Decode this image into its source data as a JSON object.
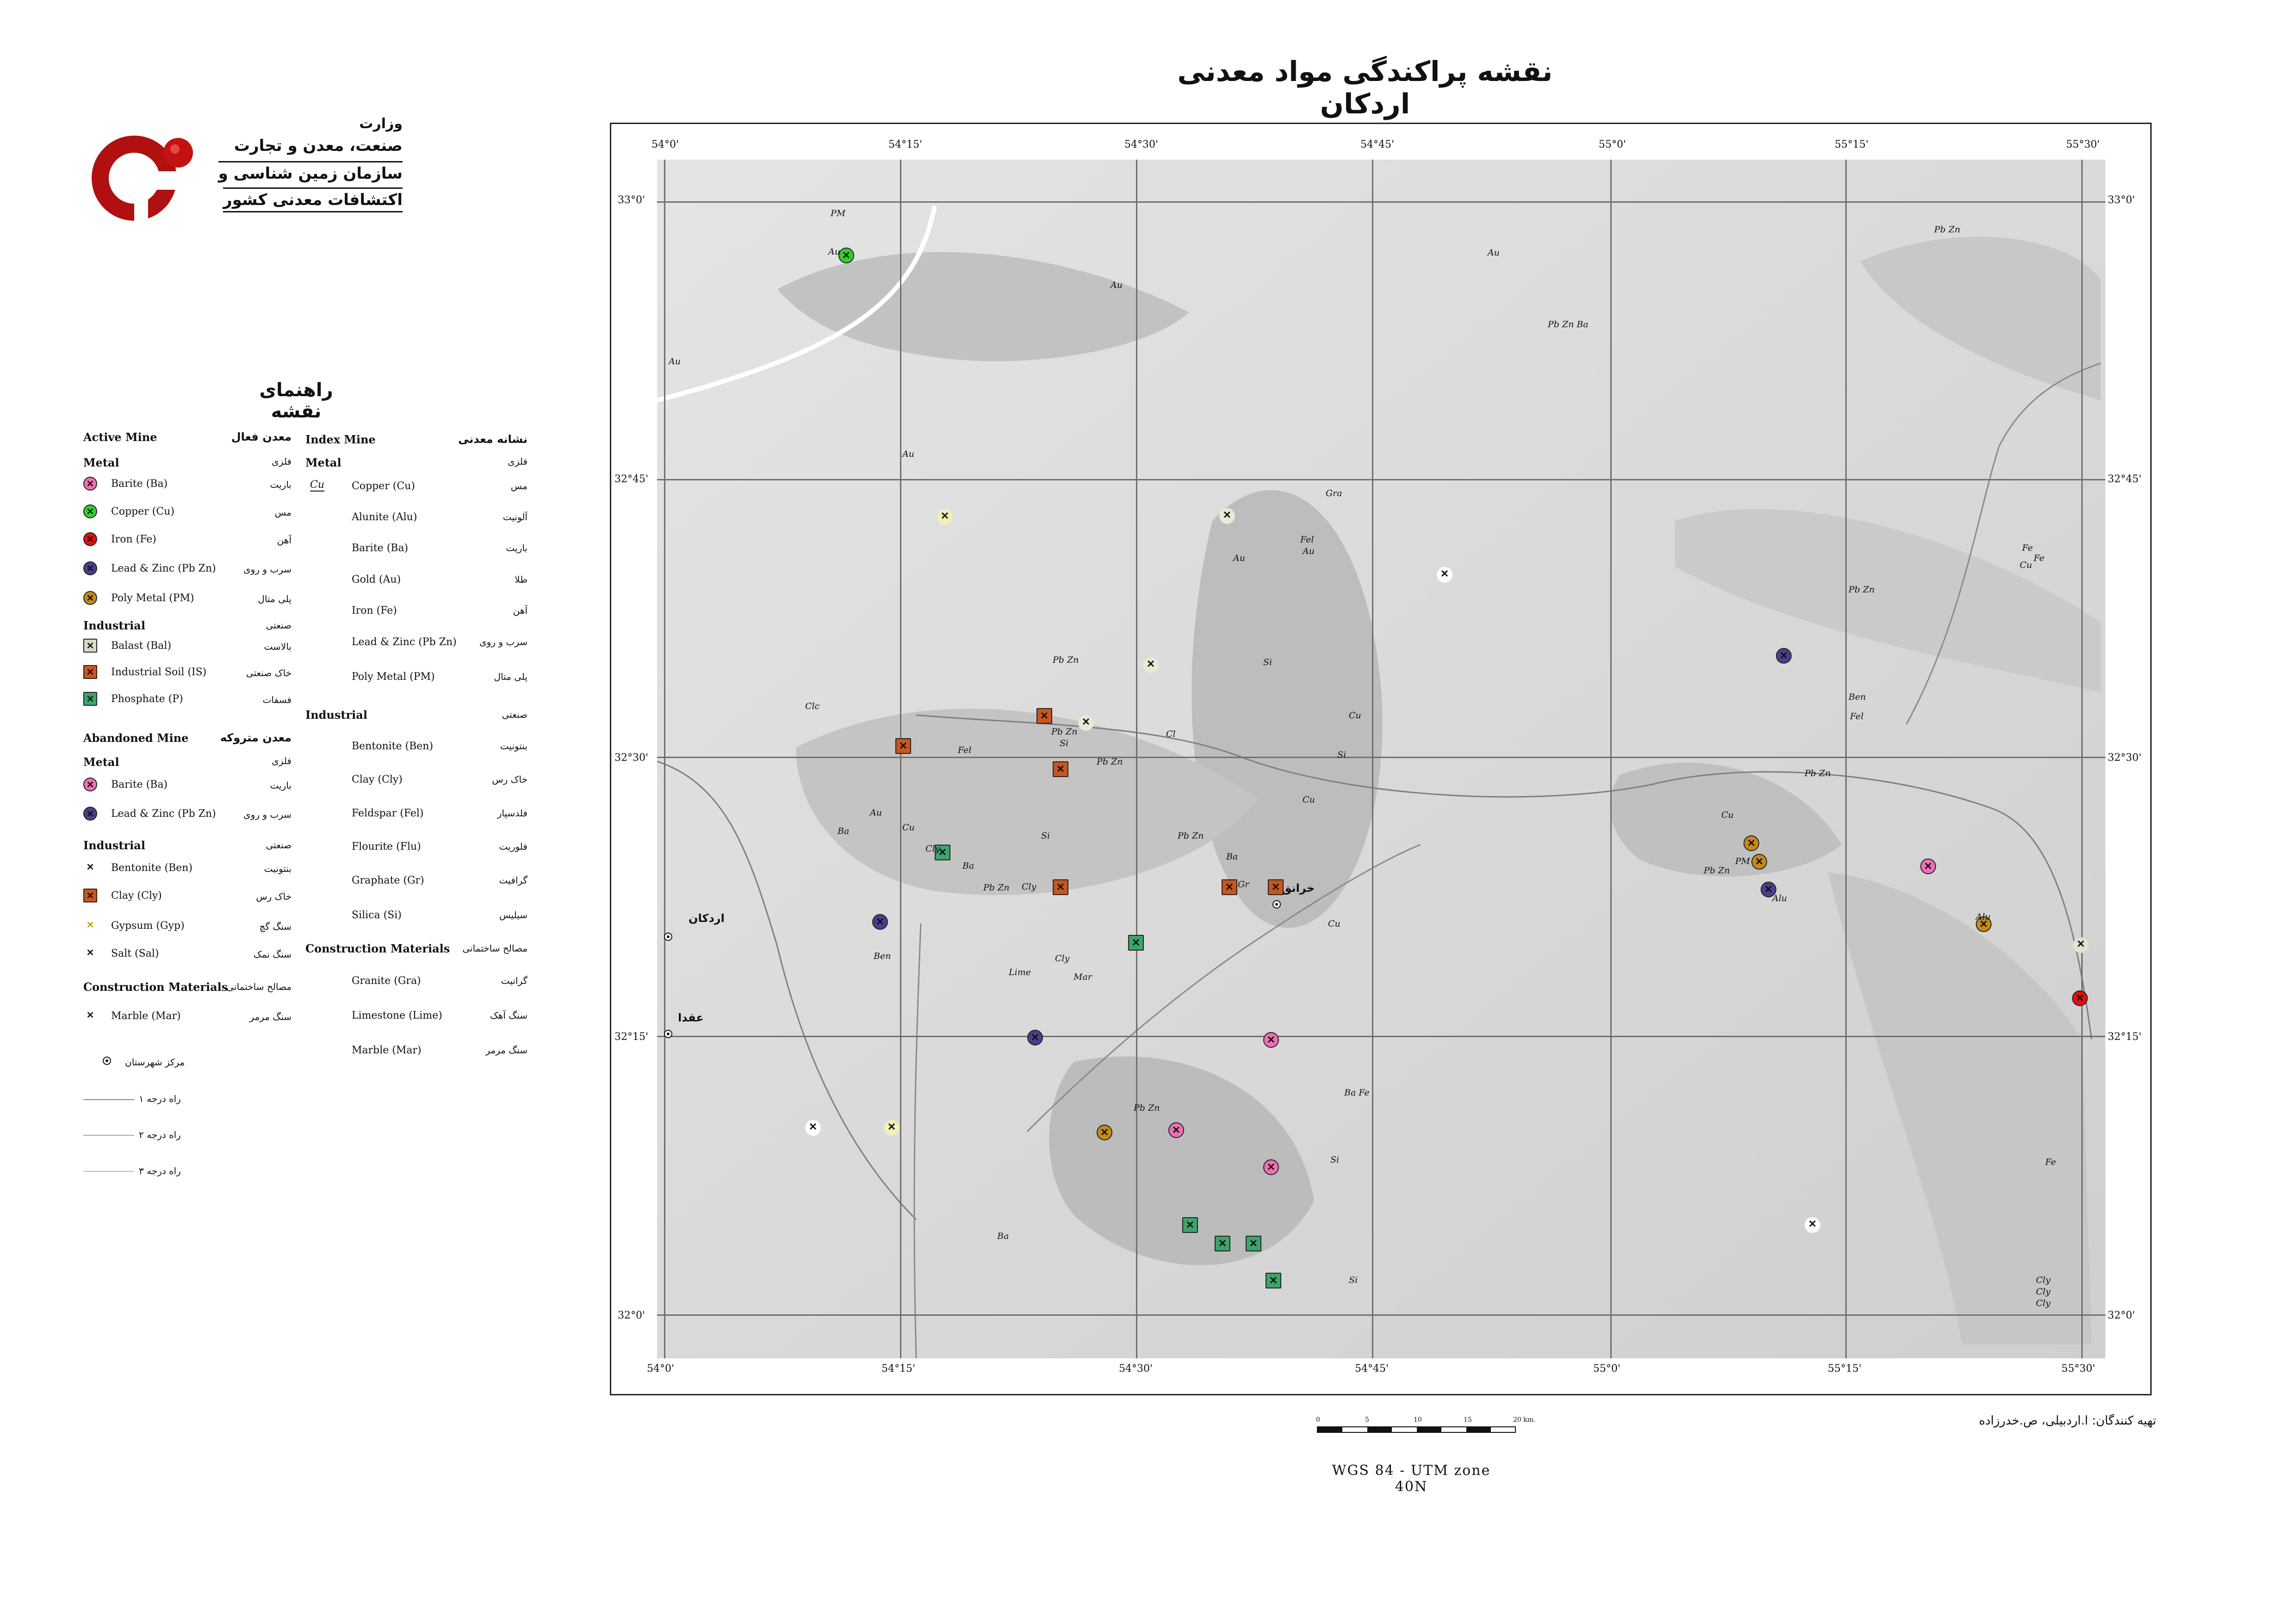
{
  "title": "نقشه پراکندگی مواد معدنی اردکان",
  "organization": {
    "lines": [
      "وزارت",
      "صنعت، معدن و تجارت",
      "سازمان زمین شناسی و",
      "اکتشافات معدنی کشور"
    ]
  },
  "legend": {
    "title": "راهنمای نقشه",
    "active_mine": {
      "heading_en": "Active Mine",
      "heading_fa": "معدن فعال",
      "metal_en": "Metal",
      "metal_fa": "فلزی",
      "metal_items": [
        {
          "en": "Barite (Ba)",
          "fa": "باریت",
          "color": "#f06fb4"
        },
        {
          "en": "Copper (Cu)",
          "fa": "مس",
          "color": "#2fcf2f"
        },
        {
          "en": "Iron (Fe)",
          "fa": "آهن",
          "color": "#e01010"
        },
        {
          "en": "Lead & Zinc (Pb Zn)",
          "fa": "سرب و روی",
          "color": "#4a3f8a"
        },
        {
          "en": "Poly Metal (PM)",
          "fa": "پلی متال",
          "color": "#c58a1a"
        }
      ],
      "industrial_en": "Industrial",
      "industrial_fa": "صنعتی",
      "industrial_items": [
        {
          "en": "Balast (Bal)",
          "fa": "بالاست",
          "color": "#d7dcc8"
        },
        {
          "en": "Industrial Soil (IS)",
          "fa": "خاک صنعتی",
          "color": "#c8561e"
        },
        {
          "en": "Phosphate (P)",
          "fa": "فسفات",
          "color": "#3da46a"
        }
      ]
    },
    "abandoned_mine": {
      "heading_en": "Abandoned Mine",
      "heading_fa": "معدن متروکه",
      "metal_en": "Metal",
      "metal_fa": "فلزی",
      "metal_items": [
        {
          "en": "Barite (Ba)",
          "fa": "باریت",
          "color": "#f06fb4"
        },
        {
          "en": "Lead & Zinc (Pb Zn)",
          "fa": "سرب و روی",
          "color": "#4a3f8a"
        }
      ],
      "industrial_en": "Industrial",
      "industrial_fa": "صنعتی",
      "industrial_items": [
        {
          "en": "Bentonite (Ben)",
          "fa": "بنتونیت",
          "color": "#f5f5dc"
        },
        {
          "en": "Clay (Cly)",
          "fa": "خاک رس",
          "color": "#c8561e"
        },
        {
          "en": "Gypsum (Gyp)",
          "fa": "سنگ گچ",
          "color": "#f0ef9a"
        },
        {
          "en": "Salt (Sal)",
          "fa": "سنگ نمک",
          "color": "#ffffff"
        }
      ],
      "construction_en": "Construction Materials",
      "construction_fa": "مصالح ساختمانی",
      "construction_items": [
        {
          "en": "Marble (Mar)",
          "fa": "سنگ مرمر",
          "color": "#f2f0d0"
        }
      ]
    },
    "index_mine": {
      "heading_en": "Index Mine",
      "heading_fa": "نشانه معدنی",
      "sample_symbol": "Cu",
      "metal_en": "Metal",
      "metal_fa": "فلزی",
      "metal_items": [
        {
          "en": "Copper (Cu)",
          "fa": "مس"
        },
        {
          "en": "Alunite (Alu)",
          "fa": "آلونیت"
        },
        {
          "en": "Barite (Ba)",
          "fa": "باریت"
        },
        {
          "en": "Gold (Au)",
          "fa": "طلا"
        },
        {
          "en": "Iron (Fe)",
          "fa": "آهن"
        },
        {
          "en": "Lead & Zinc (Pb Zn)",
          "fa": "سرب و روی"
        },
        {
          "en": "Poly Metal (PM)",
          "fa": "پلی متال"
        }
      ],
      "industrial_en": "Industrial",
      "industrial_fa": "صنعتی",
      "industrial_items": [
        {
          "en": "Bentonite (Ben)",
          "fa": "بنتونیت"
        },
        {
          "en": "Clay (Cly)",
          "fa": "خاک رس"
        },
        {
          "en": "Feldspar (Fel)",
          "fa": "فلدسپار"
        },
        {
          "en": "Flourite (Flu)",
          "fa": "فلوریت"
        },
        {
          "en": "Graphate (Gr)",
          "fa": "گرافیت"
        },
        {
          "en": "Silica (Si)",
          "fa": "سیلیس"
        }
      ],
      "construction_en": "Construction Materials",
      "construction_fa": "مصالح ساختمانی",
      "construction_items": [
        {
          "en": "Granite (Gra)",
          "fa": "گرانیت"
        },
        {
          "en": "Limestone (Lime)",
          "fa": "سنگ آهک"
        },
        {
          "en": "Marble (Mar)",
          "fa": "سنگ مرمر"
        }
      ]
    },
    "misc": [
      {
        "fa": "مرکز شهرستان",
        "kind": "city"
      },
      {
        "fa": "راه درجه ۱",
        "kind": "road1"
      },
      {
        "fa": "راه درجه ۲",
        "kind": "road2"
      },
      {
        "fa": "راه درجه ۳",
        "kind": "road3"
      }
    ]
  },
  "map": {
    "ticks_top": [
      "54°0'",
      "54°15'",
      "54°30'",
      "54°45'",
      "55°0'",
      "55°15'",
      "55°30'"
    ],
    "ticks_bottom": [
      "54°0'",
      "54°15'",
      "54°30'",
      "54°45'",
      "55°0'",
      "55°15'",
      "55°30'"
    ],
    "ticks_left": [
      "33°0'",
      "32°45'",
      "32°30'",
      "32°15'",
      "32°0'"
    ],
    "ticks_right": [
      "33°0'",
      "32°45'",
      "32°30'",
      "32°15'",
      "32°0'"
    ],
    "cities": [
      {
        "name": "اردکان"
      },
      {
        "name": "عقدا"
      },
      {
        "name": "خرانق"
      }
    ],
    "index_labels": [
      "PM",
      "Au",
      "Au",
      "Au",
      "Au",
      "Pb Zn Ba",
      "Pb Zn",
      "Au",
      "Gra",
      "Fel",
      "Au",
      "Au",
      "Fe",
      "Fe",
      "Cu",
      "Pb Zn",
      "Ben",
      "Fel",
      "Si",
      "Pb Zn",
      "Pb Zn",
      "Si",
      "Fel",
      "Si",
      "Au",
      "Cu",
      "Clc",
      "Pb Zn",
      "Cu",
      "Ba",
      "Si",
      "Pb Zn",
      "Cly",
      "Cly",
      "Pb Zn",
      "Ba",
      "Gr",
      "Ba",
      "Ben",
      "Lime",
      "Cly",
      "Mar",
      "Pb Zn",
      "Cu",
      "Alu",
      "Pb Zn",
      "Alu",
      "Cu",
      "Ba Fe",
      "Pb Zn",
      "Si",
      "Ba",
      "Si",
      "Fe",
      "Cly",
      "Cly",
      "Cly",
      "Cl",
      "Cu",
      "PM"
    ]
  },
  "scale_bar": {
    "labels": [
      "0",
      "5",
      "10",
      "15",
      "20 km."
    ]
  },
  "projection": "WGS 84 - UTM zone 40N",
  "preparers": "تهیه کنندگان: ا.اردبیلی، ص.خدرزاده"
}
